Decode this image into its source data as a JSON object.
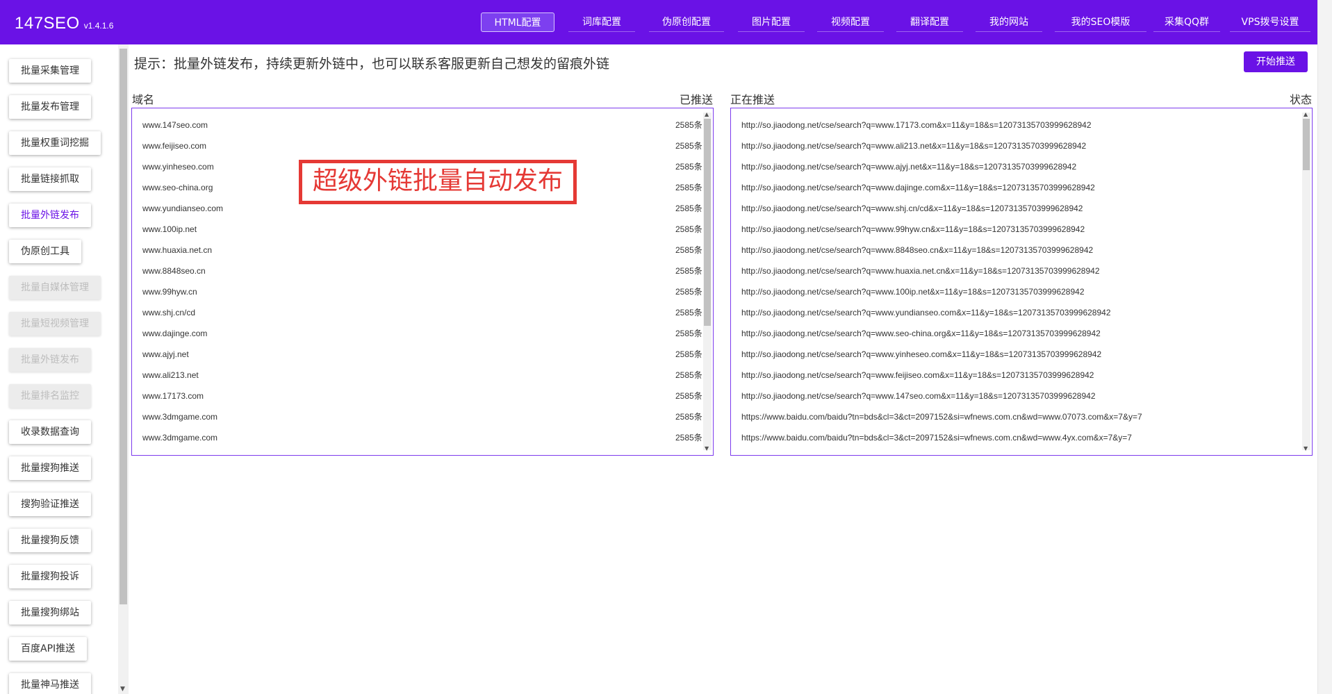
{
  "header": {
    "brand": "147SEO",
    "version": "v1.4.1.6",
    "nav": [
      {
        "label": "HTML配置",
        "active": true
      },
      {
        "label": "词库配置"
      },
      {
        "label": "伪原创配置"
      },
      {
        "label": "图片配置"
      },
      {
        "label": "视频配置"
      },
      {
        "label": "翻译配置"
      },
      {
        "label": "我的网站"
      },
      {
        "label": "我的SEO模版"
      },
      {
        "label": "采集QQ群"
      },
      {
        "label": "VPS拨号设置"
      }
    ]
  },
  "sidebar": {
    "items": [
      {
        "label": "批量采集管理",
        "state": "normal"
      },
      {
        "label": "批量发布管理",
        "state": "normal"
      },
      {
        "label": "批量权重词挖掘",
        "state": "normal"
      },
      {
        "label": "批量链接抓取",
        "state": "normal"
      },
      {
        "label": "批量外链发布",
        "state": "active"
      },
      {
        "label": "伪原创工具",
        "state": "normal"
      },
      {
        "label": "批量自媒体管理",
        "state": "disabled"
      },
      {
        "label": "批量短视频管理",
        "state": "disabled"
      },
      {
        "label": "批量外链发布",
        "state": "disabled"
      },
      {
        "label": "批量排名监控",
        "state": "disabled"
      },
      {
        "label": "收录数据查询",
        "state": "normal"
      },
      {
        "label": "批量搜狗推送",
        "state": "normal"
      },
      {
        "label": "搜狗验证推送",
        "state": "normal"
      },
      {
        "label": "批量搜狗反馈",
        "state": "normal"
      },
      {
        "label": "批量搜狗投诉",
        "state": "normal"
      },
      {
        "label": "批量搜狗绑站",
        "state": "normal"
      },
      {
        "label": "百度API推送",
        "state": "normal"
      },
      {
        "label": "批量神马推送",
        "state": "normal"
      }
    ]
  },
  "main": {
    "hint": "提示：批量外链发布，持续更新外链中，也可以联系客服更新自己想发的留痕外链",
    "start_button": "开始推送",
    "left_panel": {
      "col_domain": "域名",
      "col_pushed": "已推送",
      "rows": [
        {
          "domain": "www.147seo.com",
          "count": "2585条"
        },
        {
          "domain": "www.feijiseo.com",
          "count": "2585条"
        },
        {
          "domain": "www.yinheseo.com",
          "count": "2585条"
        },
        {
          "domain": "www.seo-china.org",
          "count": "2585条"
        },
        {
          "domain": "www.yundianseo.com",
          "count": "2585条"
        },
        {
          "domain": "www.100ip.net",
          "count": "2585条"
        },
        {
          "domain": "www.huaxia.net.cn",
          "count": "2585条"
        },
        {
          "domain": "www.8848seo.cn",
          "count": "2585条"
        },
        {
          "domain": "www.99hyw.cn",
          "count": "2585条"
        },
        {
          "domain": "www.shj.cn/cd",
          "count": "2585条"
        },
        {
          "domain": "www.dajinge.com",
          "count": "2585条"
        },
        {
          "domain": "www.ajyj.net",
          "count": "2585条"
        },
        {
          "domain": "www.ali213.net",
          "count": "2585条"
        },
        {
          "domain": "www.17173.com",
          "count": "2585条"
        },
        {
          "domain": "www.3dmgame.com",
          "count": "2585条"
        },
        {
          "domain": "www.3dmgame.com",
          "count": "2585条"
        }
      ]
    },
    "right_panel": {
      "col_pushing": "正在推送",
      "col_status": "状态",
      "rows": [
        "http://so.jiaodong.net/cse/search?q=www.17173.com&x=11&y=18&s=12073135703999628942",
        "http://so.jiaodong.net/cse/search?q=www.ali213.net&x=11&y=18&s=12073135703999628942",
        "http://so.jiaodong.net/cse/search?q=www.ajyj.net&x=11&y=18&s=12073135703999628942",
        "http://so.jiaodong.net/cse/search?q=www.dajinge.com&x=11&y=18&s=12073135703999628942",
        "http://so.jiaodong.net/cse/search?q=www.shj.cn/cd&x=11&y=18&s=12073135703999628942",
        "http://so.jiaodong.net/cse/search?q=www.99hyw.cn&x=11&y=18&s=12073135703999628942",
        "http://so.jiaodong.net/cse/search?q=www.8848seo.cn&x=11&y=18&s=12073135703999628942",
        "http://so.jiaodong.net/cse/search?q=www.huaxia.net.cn&x=11&y=18&s=12073135703999628942",
        "http://so.jiaodong.net/cse/search?q=www.100ip.net&x=11&y=18&s=12073135703999628942",
        "http://so.jiaodong.net/cse/search?q=www.yundianseo.com&x=11&y=18&s=12073135703999628942",
        "http://so.jiaodong.net/cse/search?q=www.seo-china.org&x=11&y=18&s=12073135703999628942",
        "http://so.jiaodong.net/cse/search?q=www.yinheseo.com&x=11&y=18&s=12073135703999628942",
        "http://so.jiaodong.net/cse/search?q=www.feijiseo.com&x=11&y=18&s=12073135703999628942",
        "http://so.jiaodong.net/cse/search?q=www.147seo.com&x=11&y=18&s=12073135703999628942",
        "https://www.baidu.com/baidu?tn=bds&cl=3&ct=2097152&si=wfnews.com.cn&wd=www.07073.com&x=7&y=7",
        "https://www.baidu.com/baidu?tn=bds&cl=3&ct=2097152&si=wfnews.com.cn&wd=www.4yx.com&x=7&y=7"
      ]
    },
    "banner": "超级外链批量自动发布"
  },
  "colors": {
    "accent": "#6a12e6",
    "banner_red": "#e53935"
  }
}
